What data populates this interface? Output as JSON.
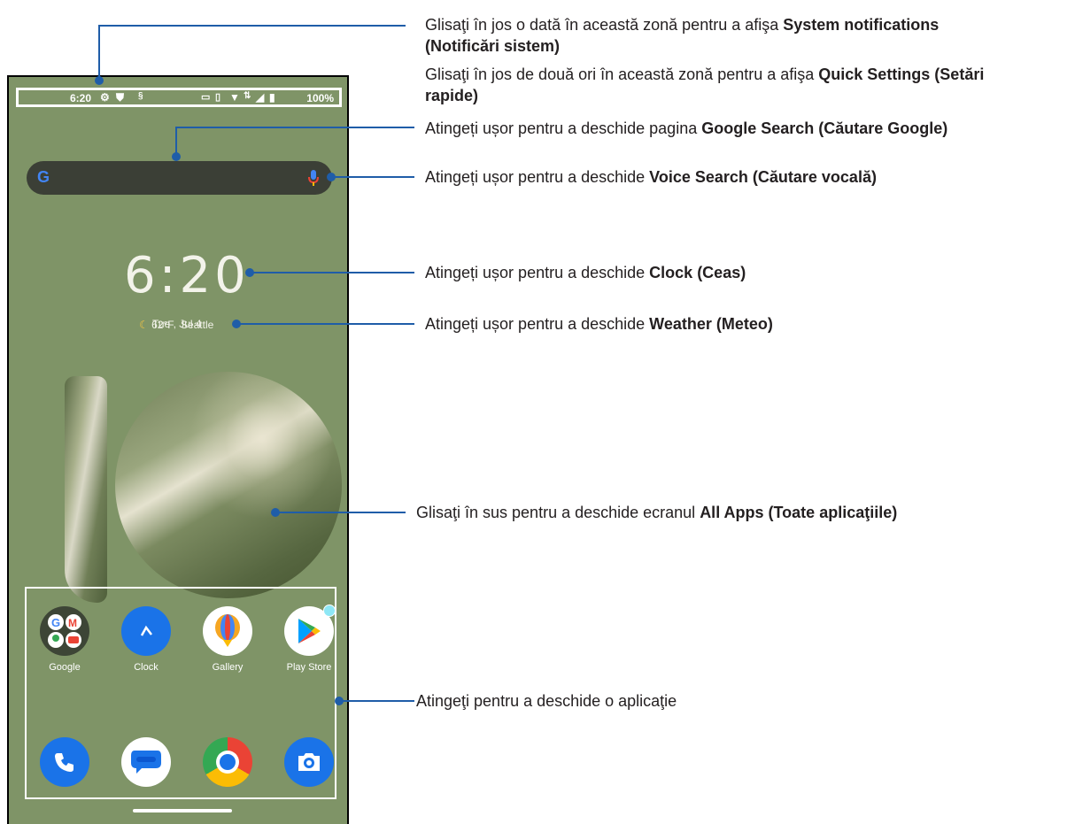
{
  "status_bar": {
    "time": "6:20",
    "battery": "100%",
    "icons": [
      "gear-icon",
      "shield-icon",
      "nfc-icon",
      "keyboard-icon",
      "vibrate-icon",
      "wifi-icon",
      "data-icon",
      "signal-icon",
      "battery-icon"
    ]
  },
  "search_bar": {
    "logo": "G",
    "mic_icon": "microphone-icon"
  },
  "clock_widget": {
    "time": "6:20",
    "date": "Tue , Jul 4"
  },
  "weather_widget": {
    "icon": "moon-icon",
    "temp": "62°F",
    "city": "Seattle"
  },
  "apps_row1": [
    {
      "label": "Google"
    },
    {
      "label": "Clock"
    },
    {
      "label": "Gallery"
    },
    {
      "label": "Play Store"
    }
  ],
  "callouts": {
    "system_notif_pre": "Glisaţi în jos o dată în această zonă pentru a afişa ",
    "system_notif_bold": "System notifications (Notificări sistem)",
    "quick_pre": "Glisaţi în jos de două ori în această zonă pentru a afişa ",
    "quick_bold": "Quick Settings (Setări rapide)",
    "google_pre": "Atingeți ușor pentru a deschide pagina ",
    "google_bold": "Google Search (Căutare Google)",
    "voice_pre": "Atingeți ușor pentru a deschide ",
    "voice_bold": "Voice Search (Căutare vocală)",
    "clock_pre": "Atingeți ușor pentru a deschide ",
    "clock_bold": "Clock (Ceas)",
    "weather_pre": "Atingeți ușor pentru a deschide ",
    "weather_bold": "Weather (Meteo)",
    "allapps_pre": "Glisaţi în sus pentru a deschide ecranul ",
    "allapps_bold": "All Apps (Toate aplicaţiile)",
    "app_text": "Atingeţi pentru a deschide o aplicaţie"
  },
  "colors": {
    "wallpaper": "#7f9467",
    "callout_line": "#1f5da8"
  }
}
